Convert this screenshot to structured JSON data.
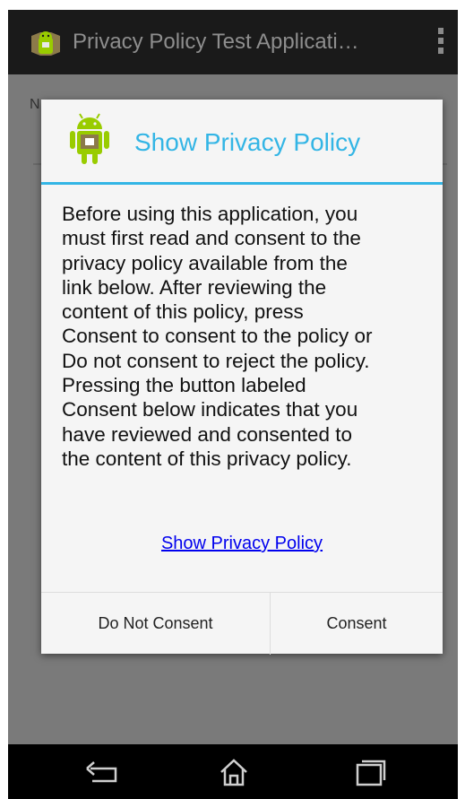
{
  "action_bar": {
    "title": "Privacy Policy Test Applicati…"
  },
  "background": {
    "label": "N"
  },
  "dialog": {
    "title": "Show Privacy Policy",
    "body_lines": [
      "Before using this application, you",
      "must first read and consent to the",
      "privacy policy available from the",
      "link below. After reviewing the",
      "content of this policy, press",
      "Consent to consent to the policy or",
      "Do not consent to reject the policy.",
      "Pressing the button labeled",
      "Consent below indicates that you",
      "have reviewed and consented to",
      "the content of this privacy policy."
    ],
    "link_text": "Show Privacy Policy",
    "buttons": {
      "decline": "Do Not Consent",
      "accept": "Consent"
    }
  },
  "nav": {
    "icons": [
      "back-icon",
      "home-icon",
      "recent-apps-icon"
    ]
  },
  "colors": {
    "accent": "#33b5e5",
    "link": "#0000ee",
    "android_green": "#99cc00"
  }
}
